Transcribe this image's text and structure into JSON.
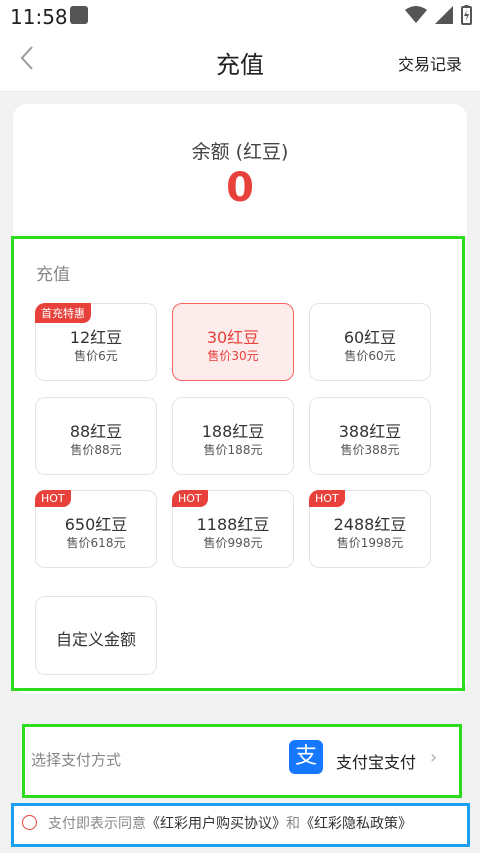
{
  "statusbar": {
    "time": "11:58"
  },
  "header": {
    "title": "充值",
    "record": "交易记录"
  },
  "balance": {
    "label": "余额 (红豆)",
    "value": "0"
  },
  "recharge": {
    "title": "充值",
    "options": [
      {
        "name": "12红豆",
        "price": "售价6元",
        "badge": "首充特惠"
      },
      {
        "name": "30红豆",
        "price": "售价30元",
        "selected": true
      },
      {
        "name": "60红豆",
        "price": "售价60元"
      },
      {
        "name": "88红豆",
        "price": "售价88元"
      },
      {
        "name": "188红豆",
        "price": "售价188元"
      },
      {
        "name": "388红豆",
        "price": "售价388元"
      },
      {
        "name": "650红豆",
        "price": "售价618元",
        "badge": "HOT"
      },
      {
        "name": "1188红豆",
        "price": "售价998元",
        "badge": "HOT"
      },
      {
        "name": "2488红豆",
        "price": "售价1998元",
        "badge": "HOT"
      }
    ],
    "custom": "自定义金额"
  },
  "payment": {
    "label": "选择支付方式",
    "method": "支付宝支付",
    "icon": "alipay-icon"
  },
  "agreement": {
    "prefix": "支付即表示同意",
    "link1": "《红彩用户购买协议》",
    "mid": "和",
    "link2": "《红彩隐私政策》"
  },
  "colors": {
    "accent": "#e8403a",
    "alipay": "#1677ff"
  }
}
